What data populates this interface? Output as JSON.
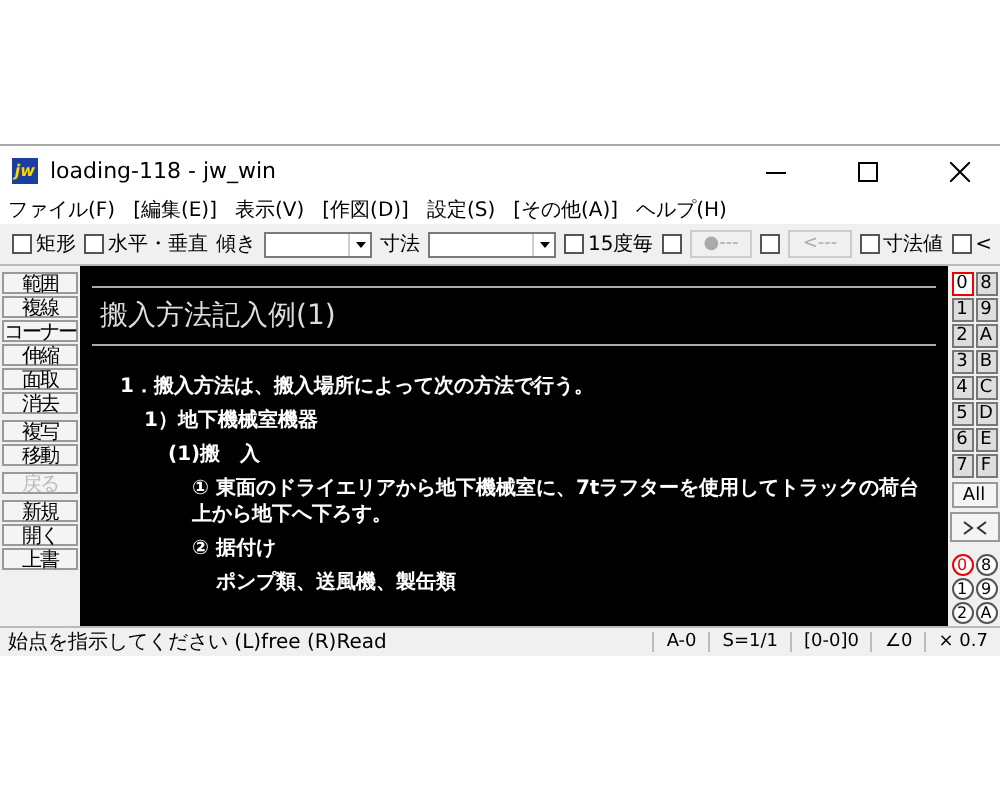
{
  "window": {
    "title": "loading-118 - jw_win",
    "icon_text": "jw"
  },
  "menu": [
    {
      "label": "ファイル(F)"
    },
    {
      "label": "[編集(E)]"
    },
    {
      "label": "表示(V)"
    },
    {
      "label": "[作図(D)]"
    },
    {
      "label": "設定(S)"
    },
    {
      "label": "[その他(A)]"
    },
    {
      "label": "ヘルプ(H)"
    }
  ],
  "toolbar": [
    {
      "kind": "check",
      "label": "矩形",
      "checked": false
    },
    {
      "kind": "check",
      "label": "水平・垂直",
      "checked": false
    },
    {
      "kind": "combo",
      "label": "傾き"
    },
    {
      "kind": "combo",
      "label": "寸法"
    },
    {
      "kind": "check",
      "label": "15度毎",
      "checked": false
    },
    {
      "kind": "check",
      "checked": false
    },
    {
      "kind": "button",
      "label": "●---",
      "disabled": true
    },
    {
      "kind": "check",
      "checked": false
    },
    {
      "kind": "button",
      "label": "<---",
      "disabled": true
    },
    {
      "kind": "check",
      "label": "寸法値",
      "checked": false
    },
    {
      "kind": "check",
      "label": "<",
      "checked": false
    }
  ],
  "left_tools": [
    {
      "items": [
        {
          "label": "範囲",
          "disabled": false
        },
        {
          "label": "複線",
          "disabled": false
        },
        {
          "label": "コーナー",
          "disabled": false
        },
        {
          "label": "伸縮",
          "disabled": false
        },
        {
          "label": "面取",
          "disabled": false
        },
        {
          "label": "消去",
          "disabled": false
        }
      ]
    },
    {
      "items": [
        {
          "label": "複写",
          "disabled": false
        },
        {
          "label": "移動",
          "disabled": false
        }
      ]
    },
    {
      "items": [
        {
          "label": "戻る",
          "disabled": true
        }
      ]
    },
    {
      "items": [
        {
          "label": "新規",
          "disabled": false
        },
        {
          "label": "開く",
          "disabled": false
        },
        {
          "label": "上書",
          "disabled": false
        }
      ]
    }
  ],
  "drawing": {
    "title": "搬入方法記入例(1)",
    "lines": [
      {
        "text": "1．搬入方法は、搬入場所によって次の方法で行う。",
        "children": [
          {
            "text": "1）地下機械室機器",
            "children": [
              {
                "text": "(1)搬　入",
                "children": [
                  {
                    "text": "① 東面のドライエリアから地下機械室に、7tラフターを使用してトラックの荷台上から地下へ下ろす。"
                  },
                  {
                    "text": "② 据付け",
                    "children": [
                      {
                        "text": "ポンプ類、送風機、製缶類"
                      }
                    ]
                  }
                ]
              }
            ]
          }
        ]
      }
    ]
  },
  "layers": [
    {
      "label": "0",
      "selected": true
    },
    {
      "label": "8",
      "selected": false
    },
    {
      "label": "1",
      "selected": false
    },
    {
      "label": "9",
      "selected": false
    },
    {
      "label": "2",
      "selected": false
    },
    {
      "label": "A",
      "selected": false
    },
    {
      "label": "3",
      "selected": false
    },
    {
      "label": "B",
      "selected": false
    },
    {
      "label": "4",
      "selected": false
    },
    {
      "label": "C",
      "selected": false
    },
    {
      "label": "5",
      "selected": false
    },
    {
      "label": "D",
      "selected": false
    },
    {
      "label": "6",
      "selected": false
    },
    {
      "label": "E",
      "selected": false
    },
    {
      "label": "7",
      "selected": false
    },
    {
      "label": "F",
      "selected": false
    }
  ],
  "layer_all": "All",
  "groups": [
    {
      "label": "0",
      "selected": true
    },
    {
      "label": "8",
      "selected": false
    },
    {
      "label": "1",
      "selected": false
    },
    {
      "label": "9",
      "selected": false
    },
    {
      "label": "2",
      "selected": false
    },
    {
      "label": "A",
      "selected": false
    }
  ],
  "status": {
    "message": "始点を指示してください (L)free (R)Read",
    "fields": [
      "A-0",
      "S=1/1",
      "[0-0]0",
      "∠0",
      "× 0.7"
    ]
  }
}
